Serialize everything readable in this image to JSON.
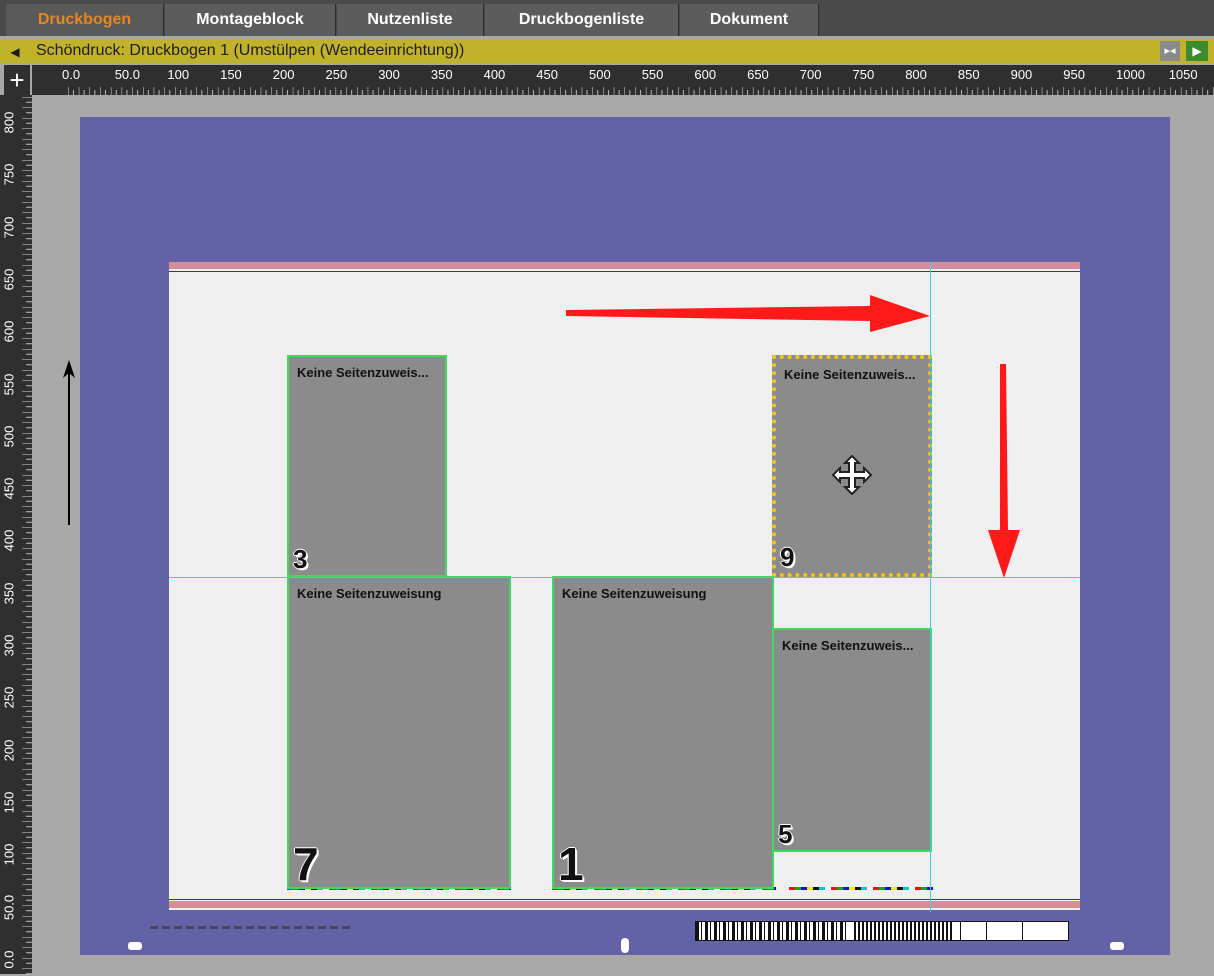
{
  "tabs": [
    {
      "label": "Druckbogen",
      "active": true
    },
    {
      "label": "Montageblock",
      "active": false
    },
    {
      "label": "Nutzenliste",
      "active": false
    },
    {
      "label": "Druckbogenliste",
      "active": false
    },
    {
      "label": "Dokument",
      "active": false
    }
  ],
  "sheet_bar": {
    "title": "Schöndruck:  Druckbogen 1 (Umstülpen (Wendeeinrichtung))",
    "prev_icon": "triangle-left-icon",
    "flip_icon": "flip-icon",
    "next_icon": "triangle-right-icon"
  },
  "ruler": {
    "horizontal": [
      "0.0",
      "50.0",
      "100",
      "150",
      "200",
      "250",
      "300",
      "350",
      "400",
      "450",
      "500",
      "550",
      "600",
      "650",
      "700",
      "750",
      "800",
      "850",
      "900",
      "950",
      "1000",
      "1050"
    ],
    "vertical": [
      "800",
      "750",
      "700",
      "650",
      "600",
      "550",
      "500",
      "450",
      "400",
      "350",
      "300",
      "250",
      "200",
      "150",
      "100",
      "50.0",
      "0.0"
    ],
    "corner_icon": "crosshair-icon"
  },
  "pages": [
    {
      "id": "3",
      "label": "Keine Seitenzuweis...",
      "number": "3",
      "selected": false
    },
    {
      "id": "9",
      "label": "Keine Seitenzuweis...",
      "number": "9",
      "selected": true
    },
    {
      "id": "7",
      "label": "Keine Seitenzuweisung",
      "number": "7",
      "selected": false
    },
    {
      "id": "1",
      "label": "Keine Seitenzuweisung",
      "number": "1",
      "selected": false
    },
    {
      "id": "5",
      "label": "Keine Seitenzuweis...",
      "number": "5",
      "selected": false
    }
  ],
  "icons": {
    "move_cursor": "move-cursor-icon",
    "direction_arrow": "arrow-up-icon",
    "annotation_right": "red-arrow-right-icon",
    "annotation_down": "red-arrow-down-icon"
  },
  "colors": {
    "active_tab": "#e8861f",
    "sheet_bar": "#c0b22b",
    "canvas": "#6462a6",
    "page_border": "#3ddb5c",
    "selection": "#f6c515",
    "guide": "#36d1e8",
    "annotation_arrow": "#ff1a1a"
  }
}
